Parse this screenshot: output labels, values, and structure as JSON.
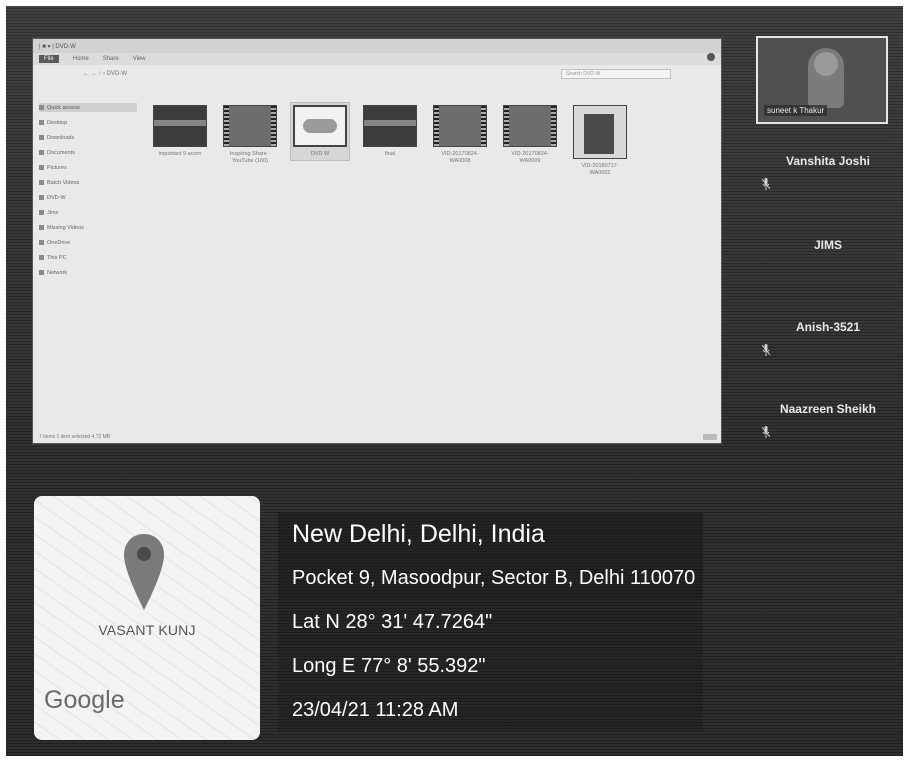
{
  "shared_screen": {
    "title_bar": "| ■ ▾ | DVD-W",
    "tabs": [
      "File",
      "Home",
      "Share",
      "View"
    ],
    "active_tab_index": 0,
    "address": "←  →  ↑  ›  DVD-W",
    "search_placeholder": "Search DVD-W",
    "nav_items": [
      {
        "label": "Quick access",
        "icon": "star-icon",
        "selected": true
      },
      {
        "label": "Desktop",
        "icon": "desktop-icon"
      },
      {
        "label": "Downloads",
        "icon": "download-icon"
      },
      {
        "label": "Documents",
        "icon": "document-icon"
      },
      {
        "label": "Pictures",
        "icon": "picture-icon"
      },
      {
        "label": "Batch Videos",
        "icon": "folder-icon"
      },
      {
        "label": "DVD-W",
        "icon": "folder-icon"
      },
      {
        "label": "Jims",
        "icon": "folder-icon"
      },
      {
        "label": "Missing Videos",
        "icon": "folder-icon"
      },
      {
        "label": "OneDrive",
        "icon": "cloud-icon"
      },
      {
        "label": "This PC",
        "icon": "computer-icon"
      },
      {
        "label": "Network",
        "icon": "network-icon"
      }
    ],
    "files": [
      {
        "label": "important 9 acorn",
        "thumb": "dark"
      },
      {
        "label": "Inspiring Share - YouTube (160)",
        "thumb": "film"
      },
      {
        "label": "DVD W",
        "thumb": "light",
        "selected": true
      },
      {
        "label": "final",
        "thumb": "dark"
      },
      {
        "label": "VID-20170824-WA0008",
        "thumb": "film"
      },
      {
        "label": "VID-20170824-WA0009",
        "thumb": "film"
      },
      {
        "label": "VID-20180717-WA0002",
        "thumb": "tall"
      }
    ],
    "status": "7 items    1 item selected  4.72 MB"
  },
  "participants": {
    "video_tile_name": "suneet k Thakur",
    "list": [
      {
        "name": "Vanshita Joshi",
        "muted": true
      },
      {
        "name": "JIMS",
        "muted": false
      },
      {
        "name": "Anish-3521",
        "muted": true
      },
      {
        "name": "Naazreen Sheikh",
        "muted": true
      }
    ]
  },
  "location_stamp": {
    "map_place": "VASANT KUNJ",
    "map_brand": "Google",
    "city": "New Delhi, Delhi, India",
    "address": "Pocket 9, Masoodpur, Sector B, Delhi 110070",
    "latitude": "Lat N 28° 31' 47.7264\"",
    "longitude": "Long E 77° 8' 55.392\"",
    "datetime": "23/04/21 11:28 AM"
  },
  "colors": {
    "background": "#2e2e2e",
    "screen": "#e9e9e9",
    "stamp_text": "#ffffff",
    "pin": "#777777"
  }
}
